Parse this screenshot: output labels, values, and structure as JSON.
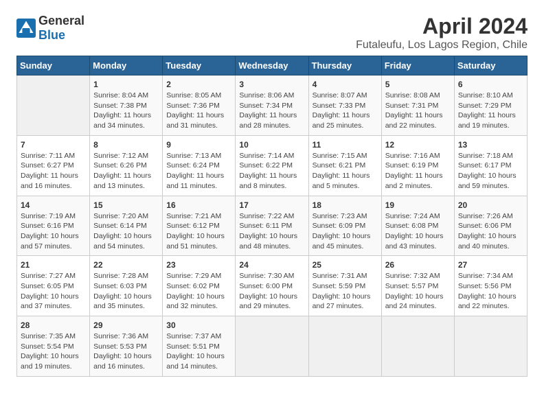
{
  "header": {
    "logo_general": "General",
    "logo_blue": "Blue",
    "title": "April 2024",
    "subtitle": "Futaleufu, Los Lagos Region, Chile"
  },
  "weekdays": [
    "Sunday",
    "Monday",
    "Tuesday",
    "Wednesday",
    "Thursday",
    "Friday",
    "Saturday"
  ],
  "weeks": [
    [
      {
        "day": "",
        "sunrise": "",
        "sunset": "",
        "daylight": ""
      },
      {
        "day": "1",
        "sunrise": "Sunrise: 8:04 AM",
        "sunset": "Sunset: 7:38 PM",
        "daylight": "Daylight: 11 hours and 34 minutes."
      },
      {
        "day": "2",
        "sunrise": "Sunrise: 8:05 AM",
        "sunset": "Sunset: 7:36 PM",
        "daylight": "Daylight: 11 hours and 31 minutes."
      },
      {
        "day": "3",
        "sunrise": "Sunrise: 8:06 AM",
        "sunset": "Sunset: 7:34 PM",
        "daylight": "Daylight: 11 hours and 28 minutes."
      },
      {
        "day": "4",
        "sunrise": "Sunrise: 8:07 AM",
        "sunset": "Sunset: 7:33 PM",
        "daylight": "Daylight: 11 hours and 25 minutes."
      },
      {
        "day": "5",
        "sunrise": "Sunrise: 8:08 AM",
        "sunset": "Sunset: 7:31 PM",
        "daylight": "Daylight: 11 hours and 22 minutes."
      },
      {
        "day": "6",
        "sunrise": "Sunrise: 8:10 AM",
        "sunset": "Sunset: 7:29 PM",
        "daylight": "Daylight: 11 hours and 19 minutes."
      }
    ],
    [
      {
        "day": "7",
        "sunrise": "Sunrise: 7:11 AM",
        "sunset": "Sunset: 6:27 PM",
        "daylight": "Daylight: 11 hours and 16 minutes."
      },
      {
        "day": "8",
        "sunrise": "Sunrise: 7:12 AM",
        "sunset": "Sunset: 6:26 PM",
        "daylight": "Daylight: 11 hours and 13 minutes."
      },
      {
        "day": "9",
        "sunrise": "Sunrise: 7:13 AM",
        "sunset": "Sunset: 6:24 PM",
        "daylight": "Daylight: 11 hours and 11 minutes."
      },
      {
        "day": "10",
        "sunrise": "Sunrise: 7:14 AM",
        "sunset": "Sunset: 6:22 PM",
        "daylight": "Daylight: 11 hours and 8 minutes."
      },
      {
        "day": "11",
        "sunrise": "Sunrise: 7:15 AM",
        "sunset": "Sunset: 6:21 PM",
        "daylight": "Daylight: 11 hours and 5 minutes."
      },
      {
        "day": "12",
        "sunrise": "Sunrise: 7:16 AM",
        "sunset": "Sunset: 6:19 PM",
        "daylight": "Daylight: 11 hours and 2 minutes."
      },
      {
        "day": "13",
        "sunrise": "Sunrise: 7:18 AM",
        "sunset": "Sunset: 6:17 PM",
        "daylight": "Daylight: 10 hours and 59 minutes."
      }
    ],
    [
      {
        "day": "14",
        "sunrise": "Sunrise: 7:19 AM",
        "sunset": "Sunset: 6:16 PM",
        "daylight": "Daylight: 10 hours and 57 minutes."
      },
      {
        "day": "15",
        "sunrise": "Sunrise: 7:20 AM",
        "sunset": "Sunset: 6:14 PM",
        "daylight": "Daylight: 10 hours and 54 minutes."
      },
      {
        "day": "16",
        "sunrise": "Sunrise: 7:21 AM",
        "sunset": "Sunset: 6:12 PM",
        "daylight": "Daylight: 10 hours and 51 minutes."
      },
      {
        "day": "17",
        "sunrise": "Sunrise: 7:22 AM",
        "sunset": "Sunset: 6:11 PM",
        "daylight": "Daylight: 10 hours and 48 minutes."
      },
      {
        "day": "18",
        "sunrise": "Sunrise: 7:23 AM",
        "sunset": "Sunset: 6:09 PM",
        "daylight": "Daylight: 10 hours and 45 minutes."
      },
      {
        "day": "19",
        "sunrise": "Sunrise: 7:24 AM",
        "sunset": "Sunset: 6:08 PM",
        "daylight": "Daylight: 10 hours and 43 minutes."
      },
      {
        "day": "20",
        "sunrise": "Sunrise: 7:26 AM",
        "sunset": "Sunset: 6:06 PM",
        "daylight": "Daylight: 10 hours and 40 minutes."
      }
    ],
    [
      {
        "day": "21",
        "sunrise": "Sunrise: 7:27 AM",
        "sunset": "Sunset: 6:05 PM",
        "daylight": "Daylight: 10 hours and 37 minutes."
      },
      {
        "day": "22",
        "sunrise": "Sunrise: 7:28 AM",
        "sunset": "Sunset: 6:03 PM",
        "daylight": "Daylight: 10 hours and 35 minutes."
      },
      {
        "day": "23",
        "sunrise": "Sunrise: 7:29 AM",
        "sunset": "Sunset: 6:02 PM",
        "daylight": "Daylight: 10 hours and 32 minutes."
      },
      {
        "day": "24",
        "sunrise": "Sunrise: 7:30 AM",
        "sunset": "Sunset: 6:00 PM",
        "daylight": "Daylight: 10 hours and 29 minutes."
      },
      {
        "day": "25",
        "sunrise": "Sunrise: 7:31 AM",
        "sunset": "Sunset: 5:59 PM",
        "daylight": "Daylight: 10 hours and 27 minutes."
      },
      {
        "day": "26",
        "sunrise": "Sunrise: 7:32 AM",
        "sunset": "Sunset: 5:57 PM",
        "daylight": "Daylight: 10 hours and 24 minutes."
      },
      {
        "day": "27",
        "sunrise": "Sunrise: 7:34 AM",
        "sunset": "Sunset: 5:56 PM",
        "daylight": "Daylight: 10 hours and 22 minutes."
      }
    ],
    [
      {
        "day": "28",
        "sunrise": "Sunrise: 7:35 AM",
        "sunset": "Sunset: 5:54 PM",
        "daylight": "Daylight: 10 hours and 19 minutes."
      },
      {
        "day": "29",
        "sunrise": "Sunrise: 7:36 AM",
        "sunset": "Sunset: 5:53 PM",
        "daylight": "Daylight: 10 hours and 16 minutes."
      },
      {
        "day": "30",
        "sunrise": "Sunrise: 7:37 AM",
        "sunset": "Sunset: 5:51 PM",
        "daylight": "Daylight: 10 hours and 14 minutes."
      },
      {
        "day": "",
        "sunrise": "",
        "sunset": "",
        "daylight": ""
      },
      {
        "day": "",
        "sunrise": "",
        "sunset": "",
        "daylight": ""
      },
      {
        "day": "",
        "sunrise": "",
        "sunset": "",
        "daylight": ""
      },
      {
        "day": "",
        "sunrise": "",
        "sunset": "",
        "daylight": ""
      }
    ]
  ]
}
